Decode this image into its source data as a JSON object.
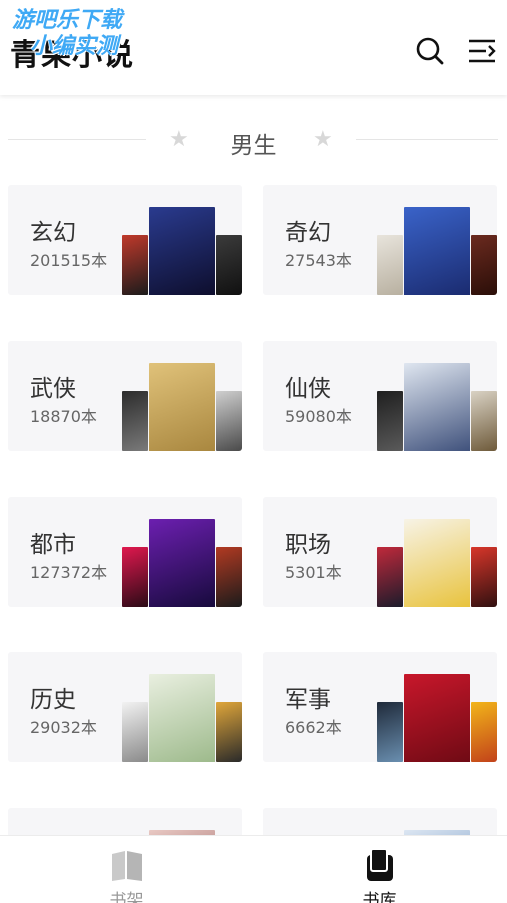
{
  "app": {
    "title": "青果小说",
    "watermark_line1": "游吧乐下载",
    "watermark_line2": "小编实测"
  },
  "header": {
    "search_icon": "search-icon",
    "menu_icon": "menu-arrow-icon"
  },
  "section": {
    "title": "男生"
  },
  "categories": [
    {
      "name": "玄幻",
      "count": "201515本",
      "covers": [
        {
          "colors": [
            "#c0392b",
            "#1b1b1b"
          ],
          "title": ""
        },
        {
          "colors": [
            "#2a3b8f",
            "#0d0d2b"
          ],
          "title": ""
        },
        {
          "colors": [
            "#3b3b3b",
            "#101010"
          ],
          "title": ""
        }
      ]
    },
    {
      "name": "奇幻",
      "count": "27543本",
      "covers": [
        {
          "colors": [
            "#e8e4dc",
            "#b8b0a0"
          ],
          "title": ""
        },
        {
          "colors": [
            "#3a63c9",
            "#1a2a6e"
          ],
          "title": ""
        },
        {
          "colors": [
            "#6b2a1f",
            "#2a0e08"
          ],
          "title": ""
        }
      ]
    },
    {
      "name": "武侠",
      "count": "18870本",
      "covers": [
        {
          "colors": [
            "#2c2c2c",
            "#7a7a7a"
          ],
          "title": ""
        },
        {
          "colors": [
            "#e0c27a",
            "#a8863e"
          ],
          "title": ""
        },
        {
          "colors": [
            "#cfcfcf",
            "#4a4a4a"
          ],
          "title": ""
        }
      ]
    },
    {
      "name": "仙侠",
      "count": "59080本",
      "covers": [
        {
          "colors": [
            "#1f1f1f",
            "#5a5a5a"
          ],
          "title": ""
        },
        {
          "colors": [
            "#dfe6f0",
            "#3d4f7a"
          ],
          "title": ""
        },
        {
          "colors": [
            "#d9d2c4",
            "#6e5a3a"
          ],
          "title": ""
        }
      ]
    },
    {
      "name": "都市",
      "count": "127372本",
      "covers": [
        {
          "colors": [
            "#e0184e",
            "#2a0a16"
          ],
          "title": ""
        },
        {
          "colors": [
            "#6c1fb0",
            "#150a3a"
          ],
          "title": ""
        },
        {
          "colors": [
            "#b23a22",
            "#1b1b1b"
          ],
          "title": ""
        }
      ]
    },
    {
      "name": "职场",
      "count": "5301本",
      "covers": [
        {
          "colors": [
            "#c0293b",
            "#1b1b2b"
          ],
          "title": ""
        },
        {
          "colors": [
            "#f7f3e6",
            "#e8c23a"
          ],
          "title": ""
        },
        {
          "colors": [
            "#d8362a",
            "#301010"
          ],
          "title": ""
        }
      ]
    },
    {
      "name": "历史",
      "count": "29032本",
      "covers": [
        {
          "colors": [
            "#f2f2f2",
            "#8a8a8a"
          ],
          "title": ""
        },
        {
          "colors": [
            "#e9efe0",
            "#9cb98a"
          ],
          "title": ""
        },
        {
          "colors": [
            "#e0a63a",
            "#2a2a2a"
          ],
          "title": ""
        }
      ]
    },
    {
      "name": "军事",
      "count": "6662本",
      "covers": [
        {
          "colors": [
            "#1f2a3a",
            "#6a8fb0"
          ],
          "title": ""
        },
        {
          "colors": [
            "#c8172b",
            "#6e0a14"
          ],
          "title": ""
        },
        {
          "colors": [
            "#f2b51a",
            "#c2421a"
          ],
          "title": ""
        }
      ]
    }
  ],
  "tabs": [
    {
      "label": "书架",
      "icon": "bookshelf-icon",
      "active": false
    },
    {
      "label": "书库",
      "icon": "library-icon",
      "active": true
    }
  ],
  "colors": {
    "accent": "#111111",
    "card_bg": "#f6f6f8",
    "inactive": "#999999"
  }
}
